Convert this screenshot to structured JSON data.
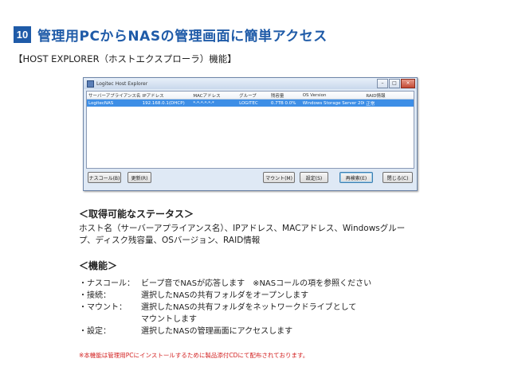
{
  "header": {
    "number": "10",
    "title": "管理用PCからNASの管理画面に簡単アクセス",
    "subtitle": "【HOST EXPLORER（ホストエクスプローラ）機能】"
  },
  "colors": {
    "accent": "#1f5ba8",
    "note": "#d32020",
    "selection": "#3d8ee6"
  },
  "window": {
    "title": "Logitec Host Explorer",
    "icon": "app-icon",
    "controls": [
      "minimize-icon",
      "maximize-icon",
      "close-icon"
    ],
    "columns": [
      "サーバーアプライアンス名",
      "IPアドレス",
      "MACアドレス",
      "グループ",
      "残容量",
      "OS Version",
      "RAID情報"
    ],
    "rows": [
      [
        "LogitecNAS",
        "192.168.0.1(DHCP)",
        "*-*-*-*-*-*",
        "LOGITEC",
        "0.7TB 0.0%",
        "Windows Storage Server 2008",
        "正常"
      ]
    ],
    "buttons": {
      "nascall": "ナスコール(B)",
      "refresh": "更新(R)",
      "mount": "マウント(M)",
      "settings": "設定(S)",
      "reconnect": "再検索(E)",
      "close": "閉じる(C)"
    }
  },
  "info": {
    "heading": "＜取得可能なステータス＞",
    "line1": "ホスト名（サーバーアプライアンス名）、IPアドレス、MACアドレス、Windowsグルー",
    "line2": "プ、ディスク残容量、OSバージョン、RAID情報"
  },
  "functions": {
    "heading": "＜機能＞",
    "items": [
      {
        "label": "・ナスコール：",
        "desc": "ビープ音でNASが応答します　※NASコールの項を参照ください"
      },
      {
        "label": "・接続：",
        "desc": "選択したNASの共有フォルダをオープンします"
      },
      {
        "label": "・マウント：",
        "desc": "選択したNASの共有フォルダをネットワークドライブとして"
      },
      {
        "label": "",
        "desc": "マウントします"
      },
      {
        "label": "・設定：",
        "desc": "選択したNASの管理画面にアクセスします"
      }
    ]
  },
  "note": "※本機能は管理用PCにインストールするために製品添付CDにて配布されております。"
}
